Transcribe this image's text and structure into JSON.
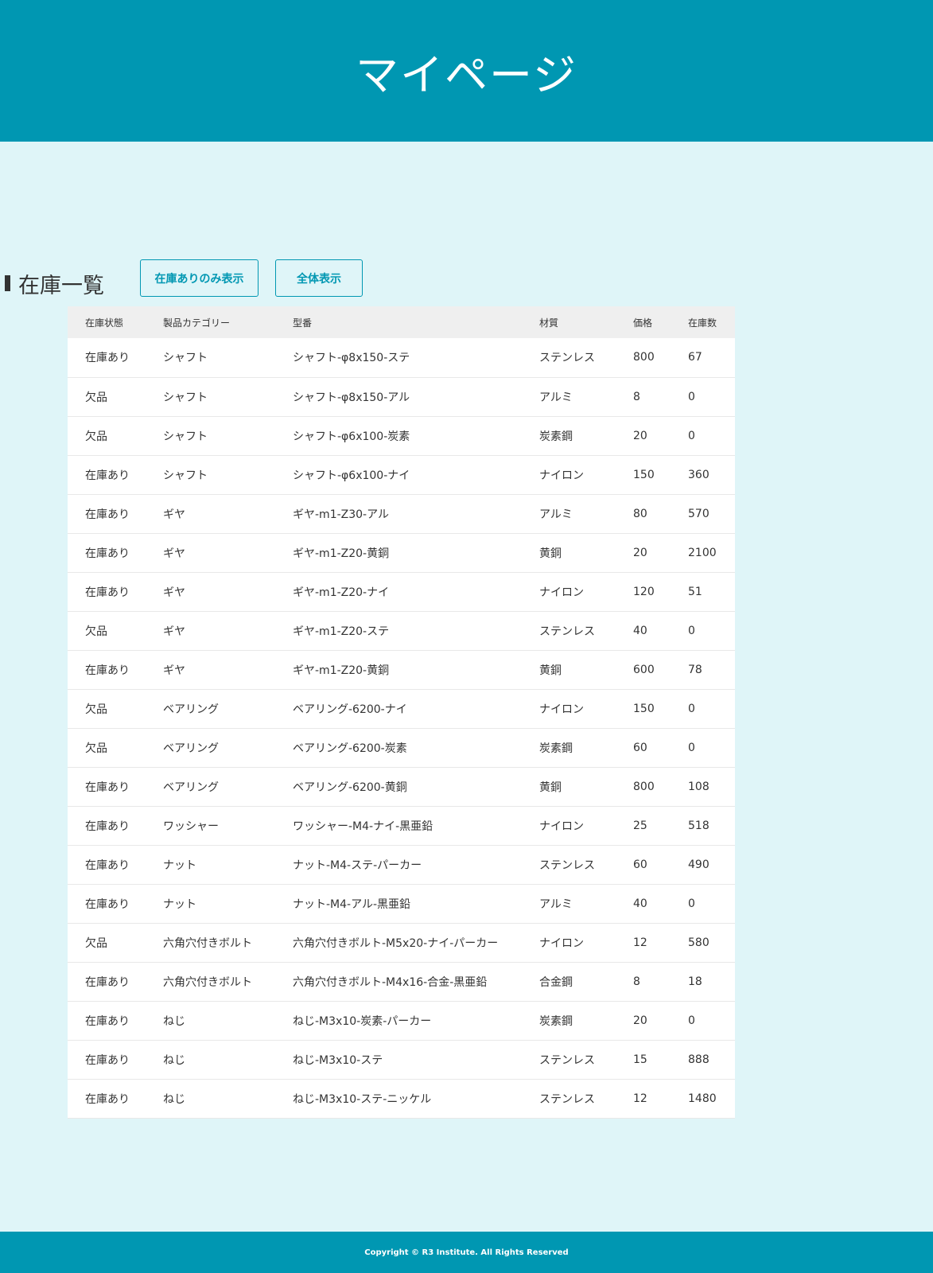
{
  "header": {
    "title": "マイページ"
  },
  "section": {
    "title": "在庫一覧"
  },
  "buttons": {
    "stock_only": "在庫ありのみ表示",
    "show_all": "全体表示"
  },
  "table": {
    "columns": [
      "在庫状態",
      "製品カテゴリー",
      "型番",
      "材質",
      "価格",
      "在庫数"
    ],
    "rows": [
      [
        "在庫あり",
        "シャフト",
        "シャフト-φ8x150-ステ",
        "ステンレス",
        "800",
        "67"
      ],
      [
        "欠品",
        "シャフト",
        "シャフト-φ8x150-アル",
        "アルミ",
        "8",
        "0"
      ],
      [
        "欠品",
        "シャフト",
        "シャフト-φ6x100-炭素",
        "炭素鋼",
        "20",
        "0"
      ],
      [
        "在庫あり",
        "シャフト",
        "シャフト-φ6x100-ナイ",
        "ナイロン",
        "150",
        "360"
      ],
      [
        "在庫あり",
        "ギヤ",
        "ギヤ-m1-Z30-アル",
        "アルミ",
        "80",
        "570"
      ],
      [
        "在庫あり",
        "ギヤ",
        "ギヤ-m1-Z20-黄銅",
        "黄銅",
        "20",
        "2100"
      ],
      [
        "在庫あり",
        "ギヤ",
        "ギヤ-m1-Z20-ナイ",
        "ナイロン",
        "120",
        "51"
      ],
      [
        "欠品",
        "ギヤ",
        "ギヤ-m1-Z20-ステ",
        "ステンレス",
        "40",
        "0"
      ],
      [
        "在庫あり",
        "ギヤ",
        "ギヤ-m1-Z20-黄銅",
        "黄銅",
        "600",
        "78"
      ],
      [
        "欠品",
        "ベアリング",
        "ベアリング-6200-ナイ",
        "ナイロン",
        "150",
        "0"
      ],
      [
        "欠品",
        "ベアリング",
        "ベアリング-6200-炭素",
        "炭素鋼",
        "60",
        "0"
      ],
      [
        "在庫あり",
        "ベアリング",
        "ベアリング-6200-黄銅",
        "黄銅",
        "800",
        "108"
      ],
      [
        "在庫あり",
        "ワッシャー",
        "ワッシャー-M4-ナイ-黒亜鉛",
        "ナイロン",
        "25",
        "518"
      ],
      [
        "在庫あり",
        "ナット",
        "ナット-M4-ステ-パーカー",
        "ステンレス",
        "60",
        "490"
      ],
      [
        "在庫あり",
        "ナット",
        "ナット-M4-アル-黒亜鉛",
        "アルミ",
        "40",
        "0"
      ],
      [
        "欠品",
        "六角穴付きボルト",
        "六角穴付きボルト-M5x20-ナイ-パーカー",
        "ナイロン",
        "12",
        "580"
      ],
      [
        "在庫あり",
        "六角穴付きボルト",
        "六角穴付きボルト-M4x16-合金-黒亜鉛",
        "合金鋼",
        "8",
        "18"
      ],
      [
        "在庫あり",
        "ねじ",
        "ねじ-M3x10-炭素-パーカー",
        "炭素鋼",
        "20",
        "0"
      ],
      [
        "在庫あり",
        "ねじ",
        "ねじ-M3x10-ステ",
        "ステンレス",
        "15",
        "888"
      ],
      [
        "在庫あり",
        "ねじ",
        "ねじ-M3x10-ステ-ニッケル",
        "ステンレス",
        "12",
        "1480"
      ]
    ]
  },
  "footer": {
    "copyright": "Copyright © R3 Institute. All Rights Reserved"
  },
  "colors": {
    "primary": "#0097b2",
    "background": "#dff5f8",
    "table_header": "#efefef"
  }
}
